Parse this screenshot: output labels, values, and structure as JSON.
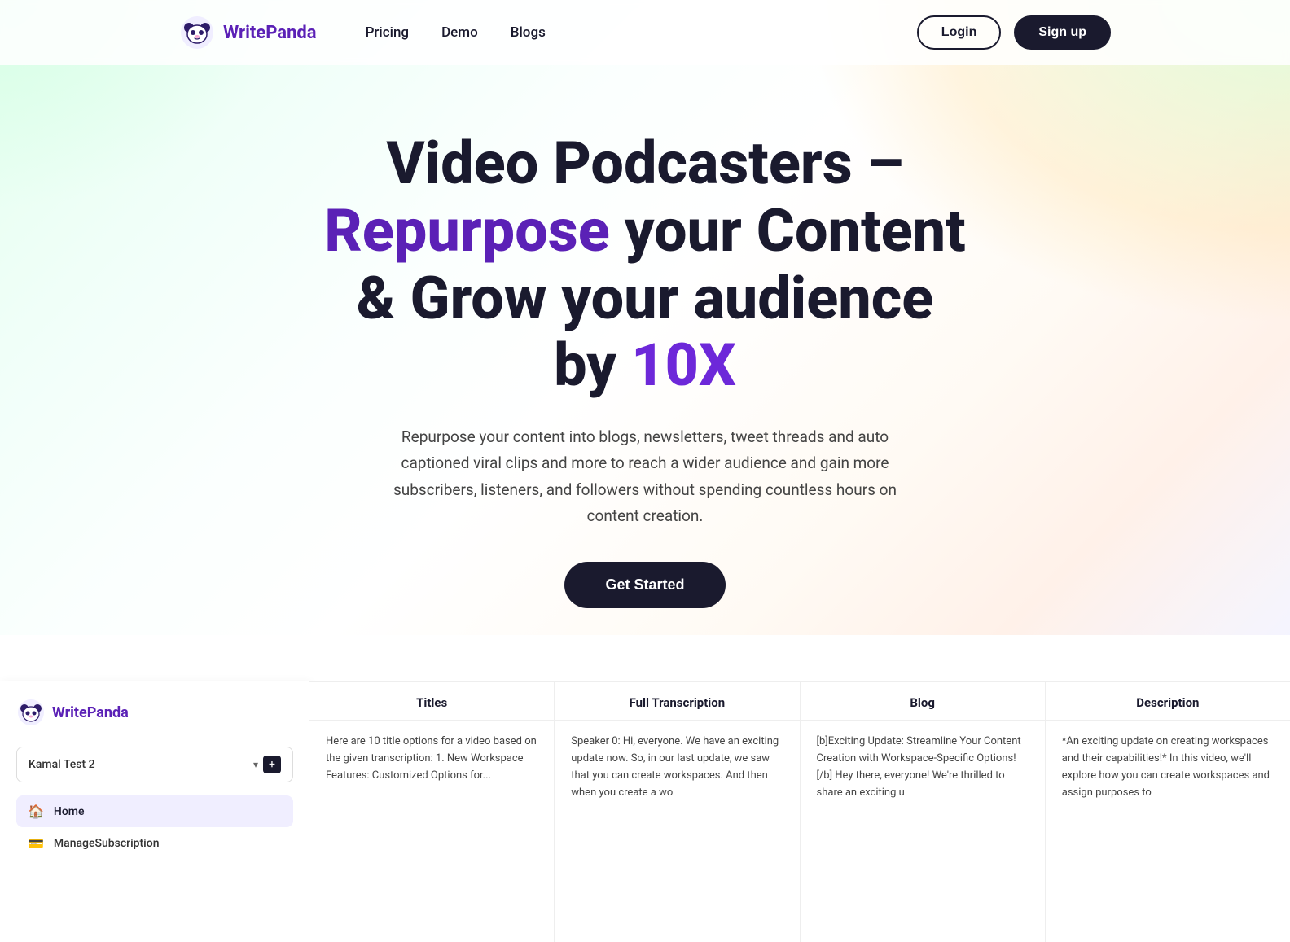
{
  "navbar": {
    "logo_text_part1": "Write",
    "logo_text_part2": "Panda",
    "nav_links": [
      {
        "label": "Pricing",
        "id": "pricing"
      },
      {
        "label": "Demo",
        "id": "demo"
      },
      {
        "label": "Blogs",
        "id": "blogs"
      }
    ],
    "login_label": "Login",
    "signup_label": "Sign up"
  },
  "hero": {
    "title_line1": "Video Podcasters –",
    "title_line2_part1": "Repurpose",
    "title_line2_part2": " your Content",
    "title_line3": "& Grow your audience",
    "title_line4_part1": "by ",
    "title_line4_part2": "10X",
    "subtitle": "Repurpose your content into blogs, newsletters, tweet threads and auto captioned viral clips and more to reach a wider audience and gain more subscribers, listeners, and followers without spending countless hours on content creation.",
    "cta_label": "Get Started"
  },
  "sidebar": {
    "logo_text_part1": "Write",
    "logo_text_part2": "Panda",
    "workspace_name": "Kamal Test 2",
    "nav_items": [
      {
        "label": "Home",
        "icon": "🏠",
        "active": true
      },
      {
        "label": "ManageSubscription",
        "icon": "💳",
        "active": false
      }
    ]
  },
  "content_columns": [
    {
      "header": "Titles",
      "body": "Here are 10 title options for a video based on the given transcription:\n\n1. New Workspace Features: Customized Options for..."
    },
    {
      "header": "Full Transcription",
      "body": "Speaker 0: Hi, everyone. We have an exciting update now. So, in our last update, we saw that you can create workspaces. And then when you create a wo"
    },
    {
      "header": "Blog",
      "body": "[b]Exciting Update: Streamline Your Content Creation with Workspace-Specific Options![/b]\n\nHey there, everyone! We're thrilled to share an exciting u"
    },
    {
      "header": "Description",
      "body": "*An exciting update on creating workspaces and their capabilities!* In this video, we'll explore how you can create workspaces and assign purposes to"
    }
  ]
}
